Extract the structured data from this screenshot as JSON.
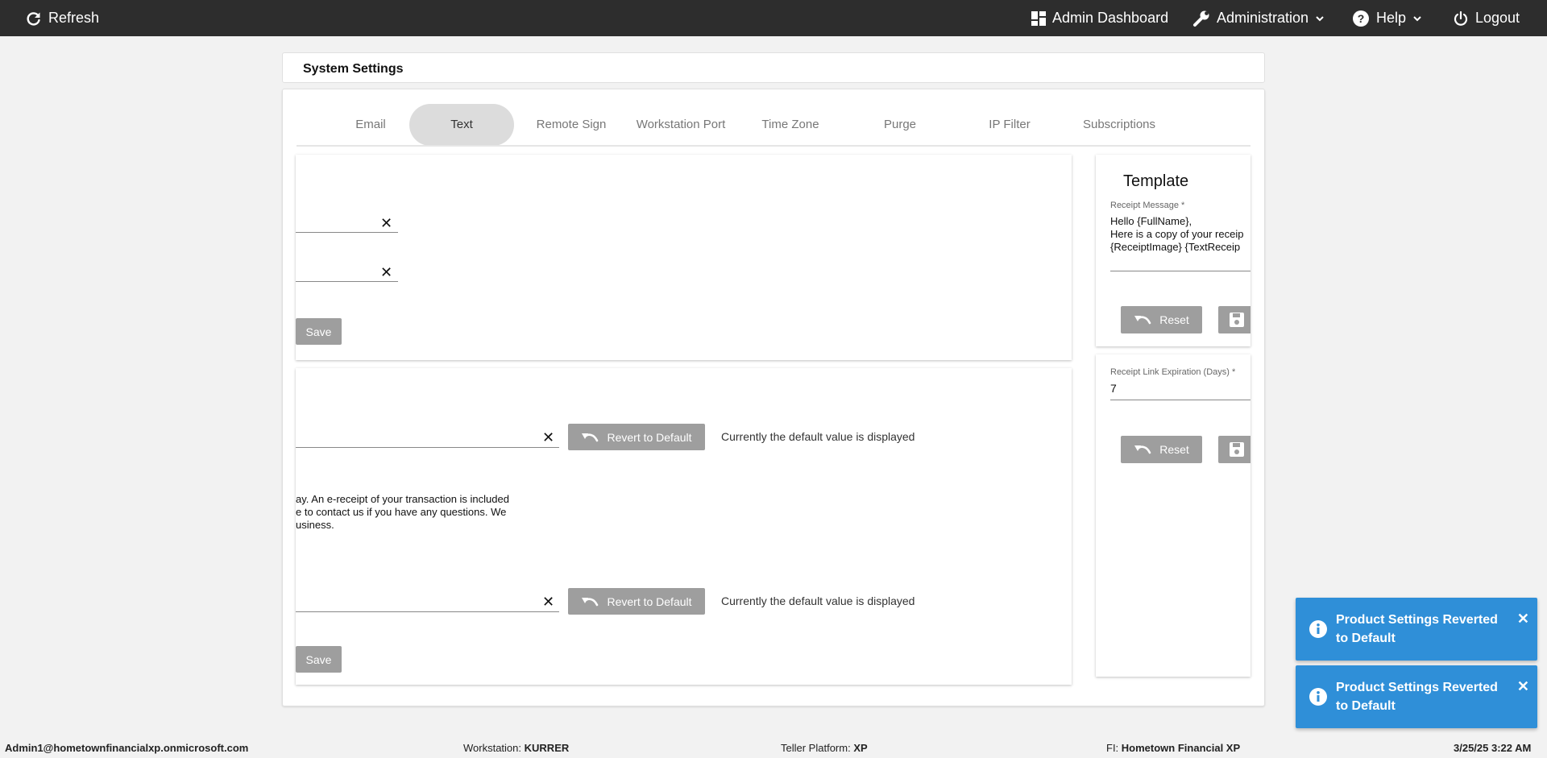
{
  "topbar": {
    "refresh": "Refresh",
    "admin_dashboard": "Admin Dashboard",
    "administration": "Administration",
    "help": "Help",
    "logout": "Logout"
  },
  "page": {
    "title": "System Settings"
  },
  "tabs": [
    {
      "label": "Email"
    },
    {
      "label": "Text"
    },
    {
      "label": "Remote Sign"
    },
    {
      "label": "Workstation Port"
    },
    {
      "label": "Time Zone"
    },
    {
      "label": "Purge"
    },
    {
      "label": "IP Filter"
    },
    {
      "label": "Subscriptions"
    }
  ],
  "panel1": {
    "save_label": "Save"
  },
  "panel2": {
    "revert_label": "Revert to Default",
    "default_hint": "Currently the default value is displayed",
    "message_lines": [
      "ay. An e-receipt of your transaction is included",
      "e to contact us if you have any questions. We",
      "usiness."
    ],
    "save_label": "Save"
  },
  "template": {
    "title": "Template",
    "receipt_message_label": "Receipt Message *",
    "receipt_message_lines": [
      "Hello {FullName},",
      "Here is a copy of your receip",
      "{ReceiptImage} {TextReceip"
    ],
    "reset_label": "Reset",
    "expiration_label": "Receipt Link Expiration (Days) *",
    "expiration_value": "7"
  },
  "statusbar": {
    "user": "Admin1@hometownfinancialxp.onmicrosoft.com",
    "workstation_label": "Workstation:",
    "workstation_value": "KURRER",
    "platform_label": "Teller Platform:",
    "platform_value": "XP",
    "fi_label": "FI:",
    "fi_value": "Hometown Financial XP",
    "datetime": "3/25/25 3:22 AM"
  },
  "toasts": [
    {
      "message": "Product Settings Reverted to Default"
    },
    {
      "message": "Product Settings Reverted to Default"
    }
  ],
  "colors": {
    "topbar": "#2d2d2d",
    "tab_underline": "#3f51b5",
    "button_gray": "#9e9e9e",
    "toast_blue": "#2f8fd8"
  }
}
